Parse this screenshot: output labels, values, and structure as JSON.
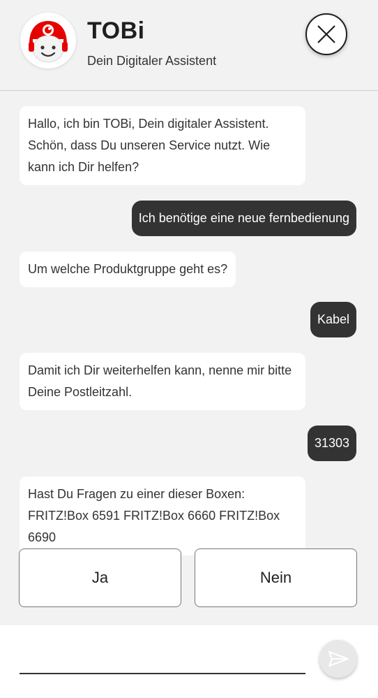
{
  "header": {
    "title": "TOBi",
    "subtitle": "Dein Digitaler Assistent",
    "close_icon": "close-icon",
    "avatar_icon": "tobi-avatar"
  },
  "messages": [
    {
      "sender": "bot",
      "text": "Hallo, ich bin TOBi, Dein digitaler Assistent. Schön, dass Du unseren Service nutzt. Wie kann ich Dir helfen?"
    },
    {
      "sender": "user",
      "text": "Ich benötige eine neue fernbedienung"
    },
    {
      "sender": "bot",
      "text": "Um welche Produktgruppe geht es?"
    },
    {
      "sender": "user",
      "text": "Kabel"
    },
    {
      "sender": "bot",
      "text": "Damit ich Dir weiterhelfen kann, nenne mir bitte Deine Postleitzahl."
    },
    {
      "sender": "user",
      "text": "31303"
    },
    {
      "sender": "bot",
      "text": "Hast Du Fragen zu einer dieser Boxen: FRITZ!Box 6591 FRITZ!Box 6660 FRITZ!Box 6690"
    }
  ],
  "quick_replies": {
    "yes": "Ja",
    "no": "Nein"
  },
  "composer": {
    "value": "",
    "send_icon": "send-icon"
  },
  "colors": {
    "brand_red": "#e60000",
    "user_bubble": "#333333",
    "background": "#f2f2f2"
  }
}
